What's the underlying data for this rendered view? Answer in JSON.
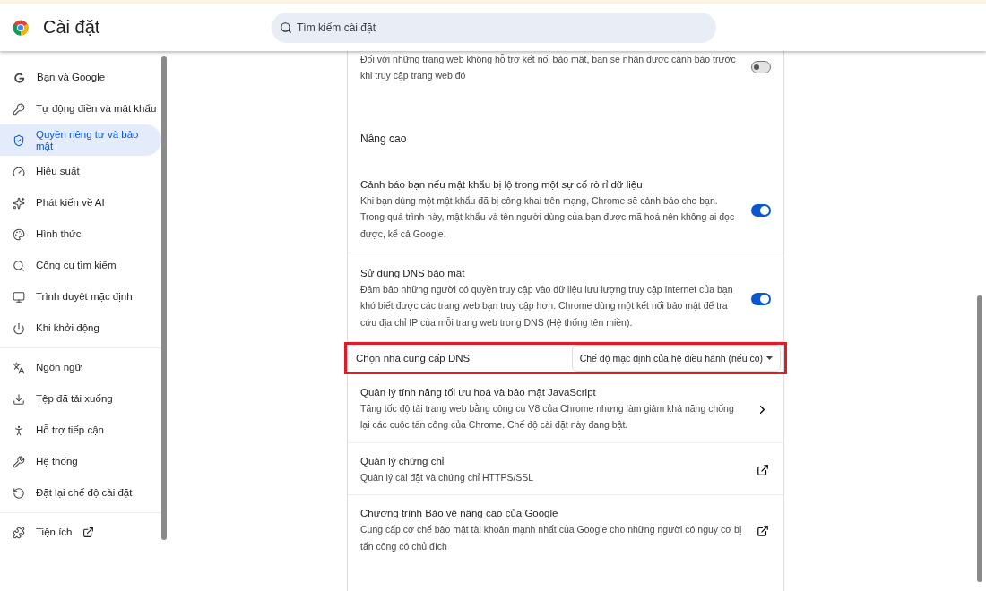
{
  "header": {
    "title": "Cài đặt",
    "search": {
      "placeholder": "Tìm kiếm cài đặt"
    }
  },
  "sidebar": {
    "groups": [
      {
        "items": [
          {
            "label": "Bạn và Google",
            "selected": false
          },
          {
            "label": "Tự động điền và mật khẩu",
            "selected": false
          },
          {
            "label": "Quyền riêng tư và bảo mật",
            "selected": true
          },
          {
            "label": "Hiệu suất",
            "selected": false
          },
          {
            "label": "Phát kiến về AI",
            "selected": false
          },
          {
            "label": "Hình thức",
            "selected": false
          },
          {
            "label": "Công cụ tìm kiếm",
            "selected": false
          },
          {
            "label": "Trình duyệt mặc định",
            "selected": false
          },
          {
            "label": "Khi khởi động",
            "selected": false
          }
        ]
      },
      {
        "items": [
          {
            "label": "Ngôn ngữ",
            "selected": false
          },
          {
            "label": "Tệp đã tải xuống",
            "selected": false
          },
          {
            "label": "Hỗ trợ tiếp cận",
            "selected": false
          },
          {
            "label": "Hệ thống",
            "selected": false
          },
          {
            "label": "Đặt lại chế độ cài đặt",
            "selected": false
          }
        ]
      },
      {
        "items": [
          {
            "label": "Tiện ích",
            "selected": false,
            "external": true
          }
        ]
      }
    ]
  },
  "settings": [
    {
      "kind": "toggle",
      "description": "Đối với những trang web không hỗ trợ kết nối bảo mật, bạn sẽ nhận được cảnh báo trước khi truy cập trang web đó",
      "on": false
    },
    {
      "kind": "heading",
      "title": "Nâng cao"
    },
    {
      "kind": "toggle",
      "title": "Cảnh báo bạn nếu mật khẩu bị lộ trong một sự cố rò rỉ dữ liệu",
      "description": "Khi bạn dùng một mật khẩu đã bị công khai trên mạng, Chrome sẽ cảnh báo cho bạn. Trong quá trình này, mật khẩu và tên người dùng của bạn được mã hoá nên không ai đọc được, kể cả Google.",
      "on": true
    },
    {
      "kind": "toggle",
      "title": "Sử dụng DNS bảo mật",
      "description": "Đảm bảo những người có quyền truy cập vào dữ liệu lưu lượng truy cập Internet của bạn khó biết được các trang web bạn truy cập hơn. Chrome dùng một kết nối bảo mật để tra cứu địa chỉ IP của mỗi trang web trong DNS (Hệ thống tên miền).",
      "on": true
    },
    {
      "kind": "select",
      "title": "Chọn nhà cung cấp DNS",
      "value": "Chế độ mặc định của hệ điều hành (nếu có)",
      "highlighted": true
    },
    {
      "kind": "arrow",
      "title": "Quản lý tính năng tối ưu hoá và bảo mật JavaScript",
      "description": "Tăng tốc độ tải trang web bằng công cụ V8 của Chrome nhưng làm giảm khả năng chống lại các cuộc tấn công của Chrome. Chế độ cài đặt này đang bật."
    },
    {
      "kind": "external",
      "title": "Quản lý chứng chỉ",
      "description": "Quản lý cài đặt và chứng chỉ HTTPS/SSL"
    },
    {
      "kind": "external",
      "title": "Chương trình Bảo vệ nâng cao của Google",
      "description": "Cung cấp cơ chế bảo mật tài khoản mạnh nhất của Google cho những người có nguy cơ bị tấn công có chủ đích"
    }
  ]
}
